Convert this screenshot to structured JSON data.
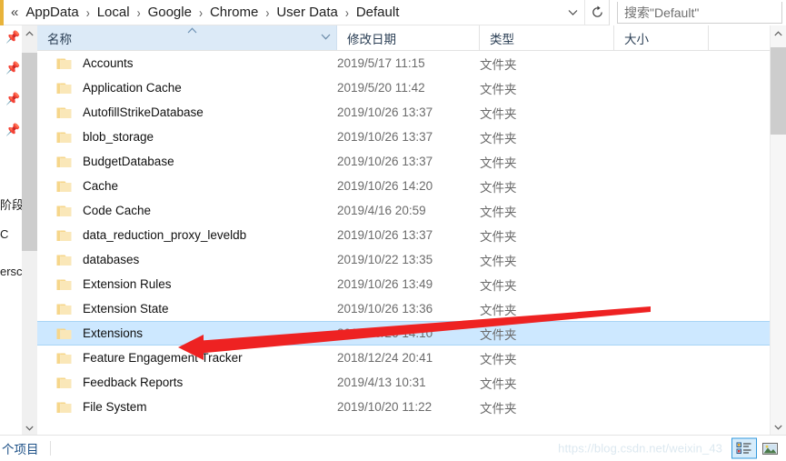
{
  "window": {
    "address": {
      "lead_glyph": "«",
      "crumbs": [
        "AppData",
        "Local",
        "Google",
        "Chrome",
        "User Data",
        "Default"
      ],
      "separator": "›",
      "dropdown_icon": "chevron-down-icon",
      "refresh_icon": "refresh-icon"
    },
    "search": {
      "placeholder": "搜索\"Default\"",
      "value": "",
      "icon": "search-icon"
    }
  },
  "nav_pane": {
    "pin_icon": "pin-icon",
    "pins": 4,
    "clipped_labels": [
      "阶段",
      "C",
      "ersc"
    ],
    "scroll_up_icon": "chevron-up-icon",
    "scroll_down_icon": "chevron-down-icon"
  },
  "columns": {
    "name": "名称",
    "date_modified": "修改日期",
    "type": "类型",
    "size": "大小",
    "sort_marker": "sort-ascending-icon",
    "dropdown_icon": "chevron-down-icon"
  },
  "files": [
    {
      "name": "Accounts",
      "date": "2019/5/17 11:15",
      "type": "文件夹",
      "size": "",
      "selected": false
    },
    {
      "name": "Application Cache",
      "date": "2019/5/20 11:42",
      "type": "文件夹",
      "size": "",
      "selected": false
    },
    {
      "name": "AutofillStrikeDatabase",
      "date": "2019/10/26 13:37",
      "type": "文件夹",
      "size": "",
      "selected": false
    },
    {
      "name": "blob_storage",
      "date": "2019/10/26 13:37",
      "type": "文件夹",
      "size": "",
      "selected": false
    },
    {
      "name": "BudgetDatabase",
      "date": "2019/10/26 13:37",
      "type": "文件夹",
      "size": "",
      "selected": false
    },
    {
      "name": "Cache",
      "date": "2019/10/26 14:20",
      "type": "文件夹",
      "size": "",
      "selected": false
    },
    {
      "name": "Code Cache",
      "date": "2019/4/16 20:59",
      "type": "文件夹",
      "size": "",
      "selected": false
    },
    {
      "name": "data_reduction_proxy_leveldb",
      "date": "2019/10/26 13:37",
      "type": "文件夹",
      "size": "",
      "selected": false
    },
    {
      "name": "databases",
      "date": "2019/10/22 13:35",
      "type": "文件夹",
      "size": "",
      "selected": false
    },
    {
      "name": "Extension Rules",
      "date": "2019/10/26 13:49",
      "type": "文件夹",
      "size": "",
      "selected": false
    },
    {
      "name": "Extension State",
      "date": "2019/10/26 13:36",
      "type": "文件夹",
      "size": "",
      "selected": false
    },
    {
      "name": "Extensions",
      "date": "2019/10/26 14:10",
      "type": "文件夹",
      "size": "",
      "selected": true
    },
    {
      "name": "Feature Engagement Tracker",
      "date": "2018/12/24 20:41",
      "type": "文件夹",
      "size": "",
      "selected": false
    },
    {
      "name": "Feedback Reports",
      "date": "2019/4/13 10:31",
      "type": "文件夹",
      "size": "",
      "selected": false
    },
    {
      "name": "File System",
      "date": "2019/10/20 11:22",
      "type": "文件夹",
      "size": "",
      "selected": false
    }
  ],
  "statusbar": {
    "count_label": "个项目",
    "watermark": "https://blog.csdn.net/weixin_43",
    "details_view_icon": "details-view-icon",
    "large_icons_view_icon": "large-icons-view-icon"
  },
  "annotation": {
    "arrow_color": "#ee2222",
    "points_at": "Extensions"
  },
  "colors": {
    "selection": "#cde8ff",
    "header_highlight": "#dceaf7",
    "folder": "#f6d68a",
    "accent": "#e8b33a"
  }
}
